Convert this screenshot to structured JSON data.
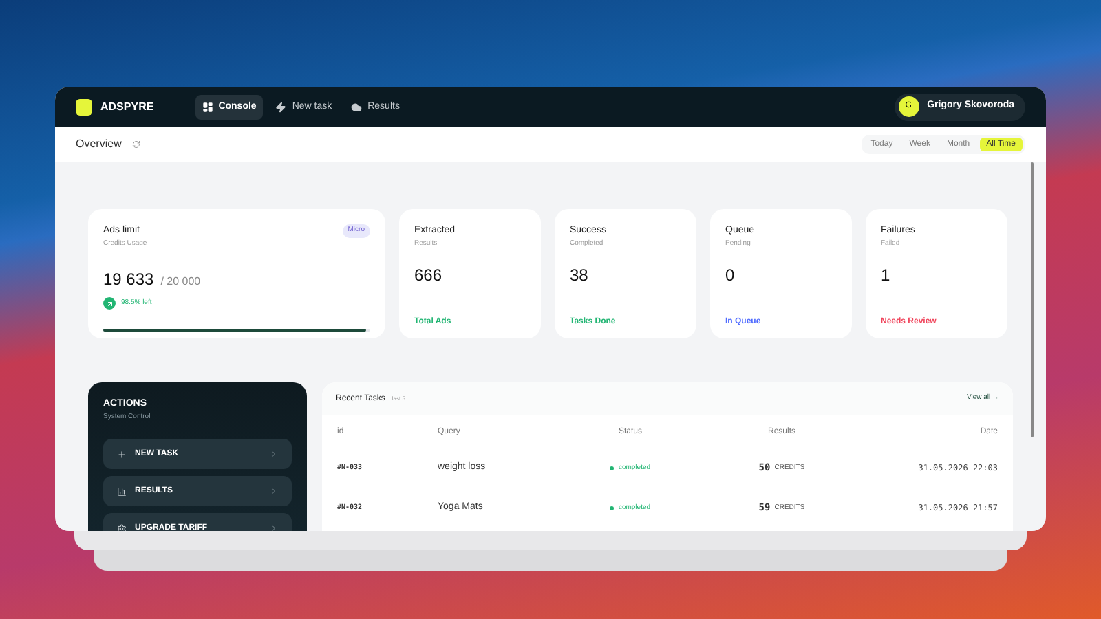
{
  "app": {
    "logo": "ADSPYRE"
  },
  "nav": [
    {
      "label": "Console",
      "selected": true,
      "kind": "console"
    },
    {
      "label": "New task",
      "selected": false,
      "kind": "task"
    },
    {
      "label": "Results",
      "selected": false,
      "kind": "results"
    }
  ],
  "user": {
    "initial": "G",
    "name": "Grigory Skovoroda"
  },
  "page": {
    "title": "Overview"
  },
  "ranges": [
    {
      "label": "Today",
      "selected": false
    },
    {
      "label": "Week",
      "selected": false
    },
    {
      "label": "Month",
      "selected": false
    },
    {
      "label": "All Time",
      "selected": true
    }
  ],
  "limit": {
    "title": "Ads limit",
    "subtitle": "Credits Usage",
    "plan": "Micro",
    "used": "19 633",
    "total": "/ 20 000",
    "left": "98.5% left",
    "level": 0.985
  },
  "stats": [
    {
      "title": "Extracted",
      "subtitle": "Results",
      "value": "666",
      "note": "Total Ads",
      "color": "#22b573"
    },
    {
      "title": "Success",
      "subtitle": "Completed",
      "value": "38",
      "note": "Tasks Done",
      "color": "#22b573"
    },
    {
      "title": "Queue",
      "subtitle": "Pending",
      "value": "0",
      "note": "In Queue",
      "color": "#4f6bff"
    },
    {
      "title": "Failures",
      "subtitle": "Failed",
      "value": "1",
      "note": "Needs Review",
      "color": "#f0445b"
    }
  ],
  "actions": {
    "title": "ACTIONS",
    "subtitle": "System Control",
    "items": [
      {
        "label": "NEW TASK",
        "kind": "create"
      },
      {
        "label": "RESULTS",
        "kind": "results"
      },
      {
        "label": "UPGRADE TARIFF",
        "kind": "upgrade"
      }
    ]
  },
  "tasks": {
    "title": "Recent Tasks",
    "count": "last 5",
    "view_all": "View all →",
    "columns": [
      "id",
      "Query",
      "Status",
      "Results",
      "Date"
    ],
    "rows": [
      {
        "id": "#N-033",
        "query": "weight loss",
        "status": "completed",
        "color": "#22b573",
        "results": "50",
        "unit": "CREDITS",
        "date": "31.05.2026 22:03"
      },
      {
        "id": "#N-032",
        "query": "Yoga Mats",
        "status": "completed",
        "color": "#22b573",
        "results": "59",
        "unit": "CREDITS",
        "date": "31.05.2026 21:57"
      }
    ]
  }
}
